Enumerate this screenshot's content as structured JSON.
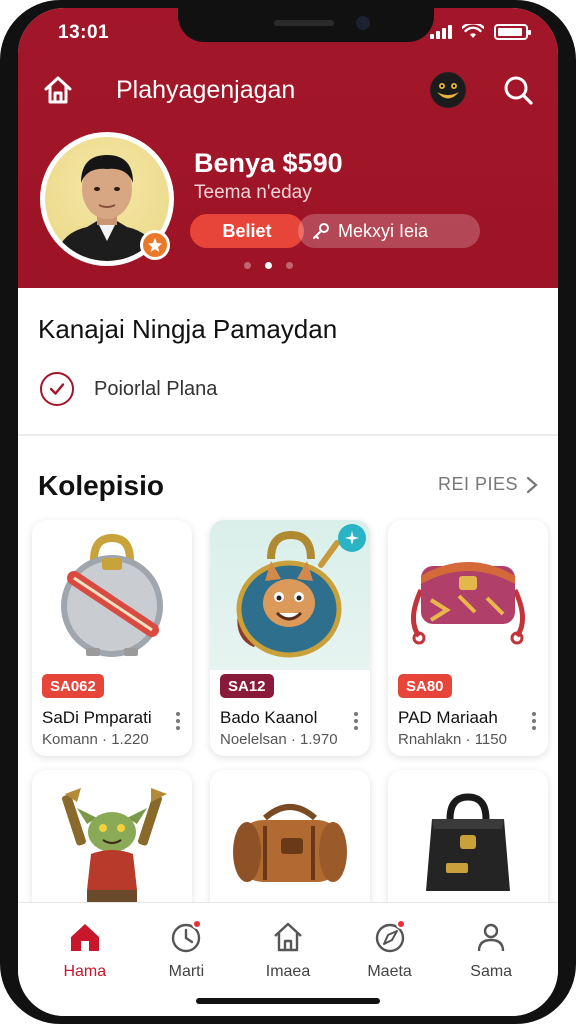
{
  "status_bar": {
    "time": "13:01"
  },
  "header": {
    "app_title": "Plahyagenjagan",
    "home_icon": "home-icon",
    "mascot_icon": "mascot-icon",
    "search_icon": "search-icon"
  },
  "profile": {
    "name": "Benya $590",
    "subtitle": "Teema n'eday",
    "primary_button": "Beliet",
    "secondary_button": "Mekxyi Ieia",
    "carousel_active_index": 1
  },
  "plan": {
    "title": "Kanajai Ningja Pamaydan",
    "item_label": "Poiorlal Plana"
  },
  "collection": {
    "title": "Kolepisio",
    "see_all": "REI PIES",
    "items": [
      {
        "price": "SA062",
        "price_color": "#e8453a",
        "name": "SaDi Pmparati",
        "meta": "Komann · 1.220",
        "image": "silver-bag"
      },
      {
        "price": "SA12",
        "price_color": "#8a1a3a",
        "name": "Bado Kaanol",
        "meta": "Noelelsan · 1.970",
        "image": "teal-cat-bag",
        "has_new_badge": true
      },
      {
        "price": "SA80",
        "price_color": "#e8453a",
        "name": "PAD Mariaah",
        "meta": "Rnahlakn · 1150",
        "image": "patterned-bag"
      },
      {
        "image": "goblin-figure"
      },
      {
        "image": "leather-duffel"
      },
      {
        "image": "black-bag"
      }
    ]
  },
  "bottom_nav": [
    {
      "label": "Hama",
      "icon": "home-icon",
      "active": true
    },
    {
      "label": "Marti",
      "icon": "clock-icon",
      "badge": true
    },
    {
      "label": "Imaea",
      "icon": "house-outline-icon"
    },
    {
      "label": "Maeta",
      "icon": "compass-icon",
      "badge": true
    },
    {
      "label": "Sama",
      "icon": "profile-icon"
    }
  ],
  "colors": {
    "brand": "#a3162a",
    "accent": "#e8453a",
    "teal": "#2ab3c5"
  }
}
